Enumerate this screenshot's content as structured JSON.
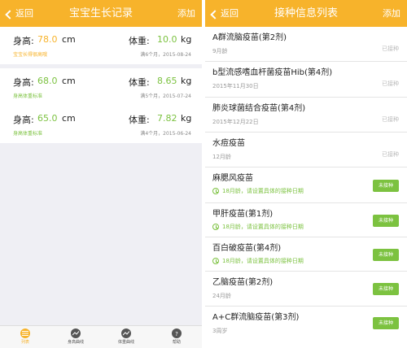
{
  "colors": {
    "accent": "#f7b32b",
    "green": "#7cc240",
    "height_value": "#f7b32b",
    "weight_value": "#7cc240"
  },
  "left": {
    "back_label": "返回",
    "title": "宝宝生长记录",
    "add_label": "添加",
    "records": [
      {
        "height_label": "身高:",
        "height": "78.0",
        "height_unit": "cm",
        "status": "宝宝长得很高哦",
        "weight_label": "体重:",
        "weight": "10.0",
        "weight_unit": "kg",
        "date": "满6个月，2015-08-24"
      },
      {
        "height_label": "身高:",
        "height": "68.0",
        "height_unit": "cm",
        "status": "身高体重标准",
        "weight_label": "体重:",
        "weight": "8.65",
        "weight_unit": "kg",
        "date": "满5个月，2015-07-24"
      },
      {
        "height_label": "身高:",
        "height": "65.0",
        "height_unit": "cm",
        "status": "身高体重标准",
        "weight_label": "体重:",
        "weight": "7.82",
        "weight_unit": "kg",
        "date": "满4个月，2015-06-24"
      }
    ],
    "tabs": [
      {
        "label": "列表",
        "icon": "list-icon"
      },
      {
        "label": "身高曲线",
        "icon": "height-curve-icon"
      },
      {
        "label": "体重曲线",
        "icon": "weight-curve-icon"
      },
      {
        "label": "帮助",
        "icon": "help-icon"
      }
    ]
  },
  "right": {
    "back_label": "返回",
    "title": "接种信息列表",
    "add_label": "添加",
    "vaccines": [
      {
        "name": "A群流脑疫苗(第2剂)",
        "sub": "9月龄",
        "status": "已接种"
      },
      {
        "name": "b型流感嗜血杆菌疫苗Hib(第4剂)",
        "sub": "2015年11月30日",
        "status": "已接种"
      },
      {
        "name": "肺炎球菌结合疫苗(第4剂)",
        "sub": "2015年12月22日",
        "status": "已接种"
      },
      {
        "name": "水痘疫苗",
        "sub": "12月龄",
        "status": "已接种"
      },
      {
        "name": "麻腮风疫苗",
        "remind": "18月龄，请设置具体的接种日期",
        "status": "未接种"
      },
      {
        "name": "甲肝疫苗(第1剂)",
        "remind": "18月龄，请设置具体的接种日期",
        "status": "未接种"
      },
      {
        "name": "百白破疫苗(第4剂)",
        "remind": "18月龄，请设置具体的接种日期",
        "status": "未接种"
      },
      {
        "name": "乙脑疫苗(第2剂)",
        "sub": "24月龄",
        "status": "未接种"
      },
      {
        "name": "A+C群流脑疫苗(第3剂)",
        "sub": "3周岁",
        "status": "未接种"
      }
    ]
  }
}
